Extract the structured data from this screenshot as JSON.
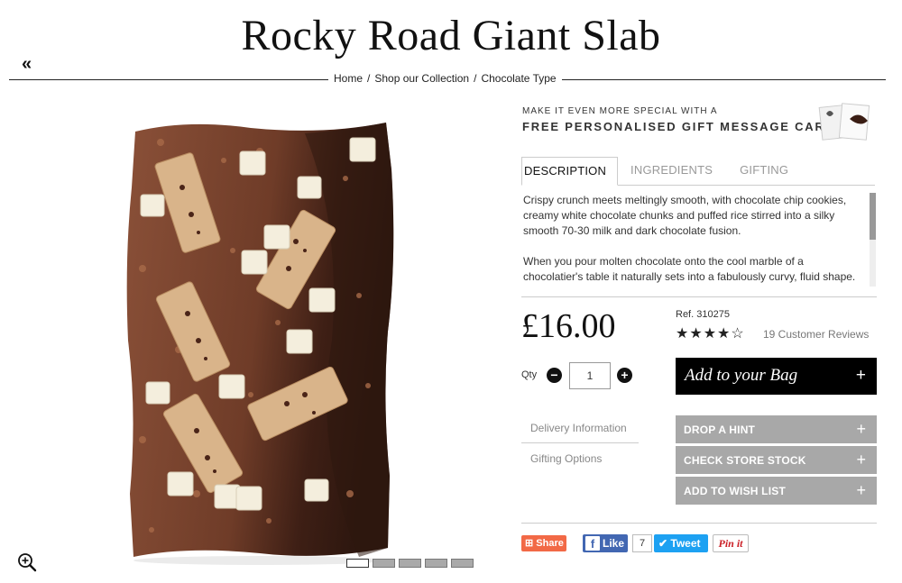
{
  "header": {
    "title": "Rocky Road Giant Slab",
    "back_icon": "double-chevron-left-icon",
    "back_glyph": "«"
  },
  "breadcrumb": {
    "home": "Home",
    "sep1": "/",
    "collection": "Shop our Collection",
    "sep2": "/",
    "type": "Chocolate Type"
  },
  "gallery": {
    "zoom_icon": "zoom-in-icon",
    "thumbnail_count": 5,
    "active_thumbnail": 1
  },
  "gift": {
    "small": "MAKE IT EVEN MORE SPECIAL WITH A",
    "large": "FREE PERSONALISED GIFT MESSAGE CARD"
  },
  "tabs": [
    {
      "label": "DESCRIPTION",
      "active": true
    },
    {
      "label": "INGREDIENTS",
      "active": false
    },
    {
      "label": "GIFTING",
      "active": false
    }
  ],
  "description": {
    "p1": "Crispy crunch meets meltingly smooth, with chocolate chip cookies, creamy white chocolate chunks and puffed rice stirred into a silky smooth 70-30 milk and dark chocolate fusion.",
    "p2": "When you pour molten chocolate onto the cool marble of a chocolatier's table it naturally sets into a fabulously curvy, fluid shape."
  },
  "product": {
    "price": "£16.00",
    "ref": "Ref. 310275",
    "rating": 4,
    "rating_max": 5,
    "stars_text": "★★★★☆",
    "reviews": "19 Customer Reviews"
  },
  "quantity": {
    "label": "Qty",
    "value": "1",
    "minus": "−",
    "plus": "+"
  },
  "add_to_bag": {
    "label": "Add to your Bag",
    "plus": "+"
  },
  "side_links": {
    "delivery": "Delivery Information",
    "gifting": "Gifting Options"
  },
  "actions": {
    "hint": "DROP A HINT",
    "stock": "CHECK STORE STOCK",
    "wishlist": "ADD TO WISH LIST",
    "plus": "+"
  },
  "social": {
    "share": "Share",
    "share_glyph": "⊞",
    "facebook": "Like",
    "facebook_glyph": "f",
    "facebook_count": "7",
    "twitter": "Tweet",
    "twitter_glyph": "✔",
    "pinterest": "Pin it"
  },
  "colors": {
    "milk_chocolate": "#7a4530",
    "dark_chocolate": "#3a1d14",
    "cookie": "#d9b48a",
    "white_chocolate": "#f4eedd",
    "share": "#f26946",
    "facebook": "#4267b2",
    "twitter": "#1da1f2",
    "pinterest": "#cb2027",
    "action_grey": "#a8a8a8"
  }
}
